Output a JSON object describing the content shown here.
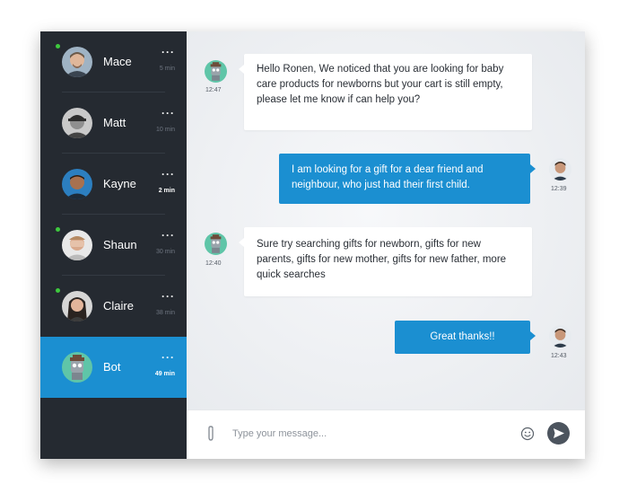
{
  "contacts": [
    {
      "name": "Mace",
      "time": "5 min",
      "online": true,
      "more": "···",
      "avatar": "mace-avatar"
    },
    {
      "name": "Matt",
      "time": "10 min",
      "online": false,
      "more": "···",
      "avatar": "matt-avatar"
    },
    {
      "name": "Kayne",
      "time": "2 min",
      "online": false,
      "more": "···",
      "avatar": "kayne-avatar"
    },
    {
      "name": "Shaun",
      "time": "30 min",
      "online": true,
      "more": "···",
      "avatar": "shaun-avatar"
    },
    {
      "name": "Claire",
      "time": "38 min",
      "online": true,
      "more": "···",
      "avatar": "claire-avatar"
    },
    {
      "name": "Bot",
      "time": "49 min",
      "online": false,
      "more": "···",
      "active": true,
      "avatar": "bot-avatar"
    }
  ],
  "messages": [
    {
      "from": "bot",
      "time": "12:47",
      "text": "Hello Ronen, We noticed that you are looking for baby care products for newborns but your cart is still empty, please let me know if can help you?"
    },
    {
      "from": "user",
      "time": "12:39",
      "text": "I am looking for a gift for a dear friend and neighbour, who just had their first child."
    },
    {
      "from": "bot",
      "time": "12:40",
      "text": "Sure try searching gifts for newborn, gifts for new parents, gifts for new mother, gifts for new father, more quick searches"
    },
    {
      "from": "user",
      "time": "12:43",
      "text": "Great thanks!!"
    }
  ],
  "composer": {
    "placeholder": "Type your message...",
    "attach_icon": "paperclip-icon",
    "emoji_icon": "smiley-icon",
    "send_icon": "send-icon"
  },
  "colors": {
    "sidebar_bg": "#252a31",
    "accent": "#1b8fd1",
    "online": "#3ec93e",
    "send_button": "#4c545e"
  }
}
